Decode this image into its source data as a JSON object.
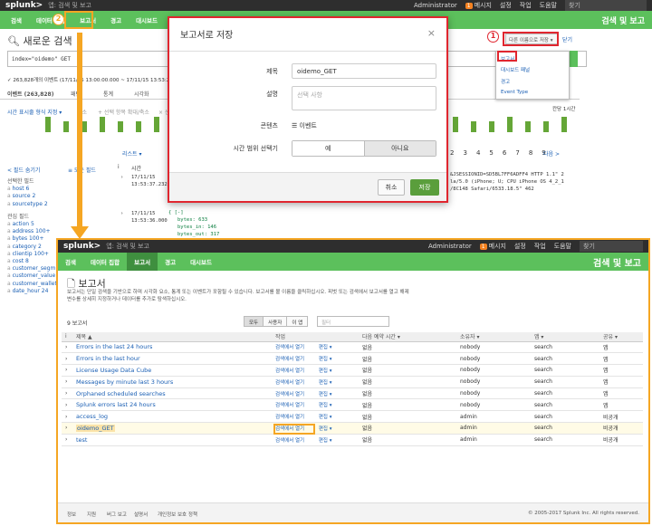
{
  "colors": {
    "accent_green": "#5cc05c",
    "topbar": "#2e2e2e",
    "annotation_red": "#e0262f",
    "annotation_yellow": "#f5a623"
  },
  "topbar": {
    "logo": "splunk>",
    "app": "앱: 검색 및 보고",
    "user": "Administrator",
    "msg_count": "1",
    "messages": "메시지",
    "settings": "설정",
    "activity": "작업",
    "help": "도움말",
    "find": "찾기"
  },
  "appbar": {
    "tabs": [
      "검색",
      "데이터 집합",
      "보고서",
      "경고",
      "대시보드"
    ],
    "title": "검색 및 보고"
  },
  "search": {
    "title": "새로운 검색",
    "query": "index=\"oidemo\" GET",
    "status": "✓ 263,828개의 이벤트 (17/11/15 13:00:00.000 ~ 17/11/15 13:53:2",
    "tabs": [
      "이벤트 (263,828)",
      "패턴",
      "통계",
      "시각화"
    ],
    "timeline_format": "시간 표시줄 형식 지정 ▾",
    "zoom_out": "축소",
    "zoom_sel": "+ 선택 항목 확대/축소",
    "deselect": "× 선택 해제",
    "per_col": "칸당 1시간",
    "list": "리스트 ▾",
    "hide_fields": "< 필드 숨기기",
    "all_fields": "≡ 모든 필드",
    "col_i": "i",
    "col_time": "시간",
    "pages": [
      "2",
      "3",
      "4",
      "5",
      "6",
      "7",
      "8",
      "9"
    ],
    "next": "다음 >",
    "selected_fields_title": "선택한 필드",
    "selected_fields": [
      [
        "host",
        "6"
      ],
      [
        "source",
        "2"
      ],
      [
        "sourcetype",
        "2"
      ]
    ],
    "interesting_fields_title": "관심 필드",
    "interesting_fields": [
      [
        "action",
        "5"
      ],
      [
        "address",
        "100+"
      ],
      [
        "bytes",
        "100+"
      ],
      [
        "category",
        "2"
      ],
      [
        "clientip",
        "100+"
      ],
      [
        "cost",
        "8"
      ],
      [
        "customer_segm",
        ""
      ],
      [
        "customer_value",
        ""
      ],
      [
        "customer_wallet",
        ""
      ],
      [
        "date_hour",
        "24"
      ]
    ],
    "event1_time": [
      "17/11/15",
      "13:53:37.232"
    ],
    "event1_lines": [
      "&JSESSIONID=SD5BL7FF6ADFF4 HTTP 1.1\" 2",
      "la/5.0 (iPhone; U; CPU iPhone OS 4_2_1",
      "/8C148 Safari/6533.18.5\" 462"
    ],
    "event2_time": [
      "17/11/15",
      "13:53:36.000"
    ],
    "event2_lines": [
      "{ [-]",
      "bytes: 633",
      "bytes_in: 146",
      "bytes_out: 317"
    ]
  },
  "dropdown": {
    "button": "다른 이름으로 저장 ▾",
    "close": "닫기",
    "items": [
      "보고서",
      "대시보드 패널",
      "경고",
      "Event Type"
    ]
  },
  "annotations": {
    "one": "1",
    "two": "2"
  },
  "modal": {
    "title": "보고서로 저장",
    "close": "×",
    "title_label": "제목",
    "title_value": "oidemo_GET",
    "desc_label": "설명",
    "desc_placeholder": "선택 사항",
    "content_label": "콘텐츠",
    "content_value": "☰ 이벤트",
    "time_label": "시간 범위 선택기",
    "yes": "예",
    "no": "아니요",
    "cancel": "취소",
    "save": "저장"
  },
  "reports": {
    "title": "보고서",
    "description": "보고서는 단일 검색을 기반으로 하며 시각화 요소, 통계 또는 이벤트가 포함될 수 있습니다. 보고서를 볼 이름을 클릭하십시오. 피벗 또는 검색에서 보고서를 열고 해제 변수를 상세히 지정하거나 데이터를 추가로 탐색하십시오.",
    "count": "9 보고서",
    "filters": [
      "모두",
      "사용자",
      "이 앱"
    ],
    "filter_placeholder": "필터",
    "columns": [
      "i",
      "제목 ▲",
      "작업",
      "다음 예약 시간 ▾",
      "소유자 ▾",
      "앱 ▾",
      "공유 ▾"
    ],
    "rows": [
      {
        "title": "Errors in the last 24 hours",
        "action": "검색에서 열기",
        "edit": "편집 ▾",
        "next": "없음",
        "owner": "nobody",
        "app": "search",
        "share": "앱"
      },
      {
        "title": "Errors in the last hour",
        "action": "검색에서 열기",
        "edit": "편집 ▾",
        "next": "없음",
        "owner": "nobody",
        "app": "search",
        "share": "앱"
      },
      {
        "title": "License Usage Data Cube",
        "action": "검색에서 열기",
        "edit": "편집 ▾",
        "next": "없음",
        "owner": "nobody",
        "app": "search",
        "share": "앱"
      },
      {
        "title": "Messages by minute last 3 hours",
        "action": "검색에서 열기",
        "edit": "편집 ▾",
        "next": "없음",
        "owner": "nobody",
        "app": "search",
        "share": "앱"
      },
      {
        "title": "Orphaned scheduled searches",
        "action": "검색에서 열기",
        "edit": "편집 ▾",
        "next": "없음",
        "owner": "nobody",
        "app": "search",
        "share": "앱"
      },
      {
        "title": "Splunk errors last 24 hours",
        "action": "검색에서 열기",
        "edit": "편집 ▾",
        "next": "없음",
        "owner": "nobody",
        "app": "search",
        "share": "앱"
      },
      {
        "title": "access_log",
        "action": "검색에서 열기",
        "edit": "편집 ▾",
        "next": "없음",
        "owner": "admin",
        "app": "search",
        "share": "비공개"
      },
      {
        "title": "oidemo_GET",
        "action": "검색에서 열기",
        "edit": "편집 ▾",
        "next": "없음",
        "owner": "admin",
        "app": "search",
        "share": "비공개"
      },
      {
        "title": "test",
        "action": "검색에서 열기",
        "edit": "편집 ▾",
        "next": "없음",
        "owner": "admin",
        "app": "search",
        "share": "비공개"
      }
    ],
    "footer": [
      "정보",
      "지원",
      "버그 보고",
      "설명서",
      "개인정보 보호 정책"
    ],
    "copyright": "© 2005-2017 Splunk Inc. All rights reserved."
  }
}
